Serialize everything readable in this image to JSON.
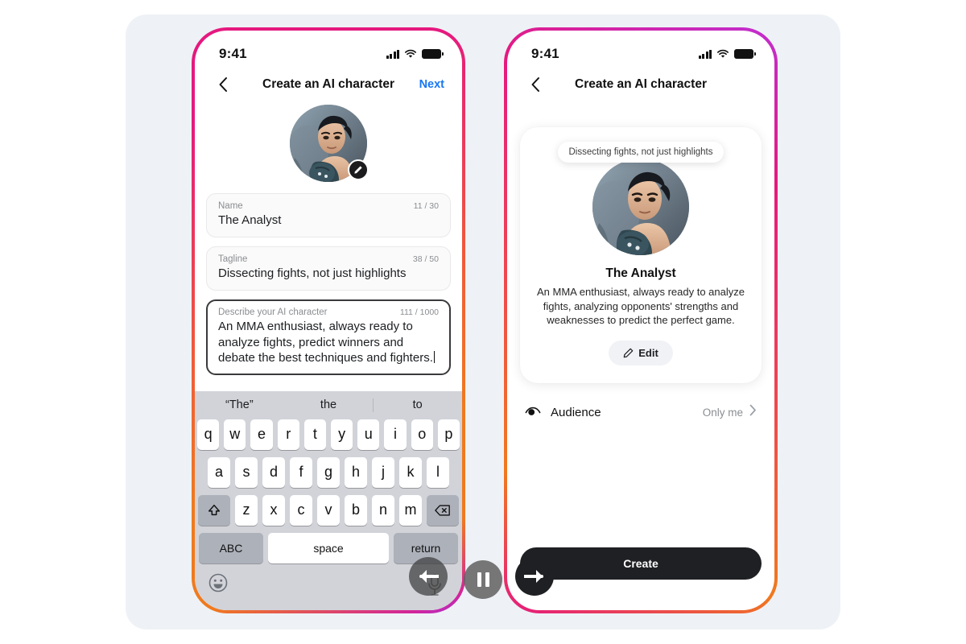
{
  "theme": {
    "stage_bg": "#eef2f6",
    "accent_link": "#1877f2",
    "dark_button": "#1f2023",
    "keyboard_bg": "#d1d3d9",
    "muted_text": "#8a8d91",
    "frame_gradient_left": "#e5197f → #f07a1e → #a832d6",
    "frame_gradient_right": "#c02fd0 → #e5197f → #f07a1e"
  },
  "left_phone": {
    "status": {
      "time": "9:41",
      "cellular": "signal-bars",
      "wifi": "wifi",
      "battery": "battery-full"
    },
    "nav": {
      "back": "chevron-left",
      "title": "Create an AI character",
      "next_label": "Next"
    },
    "avatar": {
      "alt": "MMA fighter character portrait",
      "edit_badge": "pencil-icon"
    },
    "fields": [
      {
        "key": "name",
        "label": "Name",
        "count": "11 / 30",
        "value": "The Analyst",
        "focused": false
      },
      {
        "key": "tagline",
        "label": "Tagline",
        "count": "38 / 50",
        "value": "Dissecting fights, not just highlights",
        "focused": false
      },
      {
        "key": "description",
        "label": "Describe your AI character",
        "count": "111 / 1000",
        "value": "An MMA enthusiast, always ready to analyze fights, predict winners and debate the best techniques and fighters.",
        "focused": true
      }
    ],
    "keyboard": {
      "suggestions": [
        "“The”",
        "the",
        "to"
      ],
      "row1": [
        "q",
        "w",
        "e",
        "r",
        "t",
        "y",
        "u",
        "i",
        "o",
        "p"
      ],
      "row2": [
        "a",
        "s",
        "d",
        "f",
        "g",
        "h",
        "j",
        "k",
        "l"
      ],
      "row3": [
        "z",
        "x",
        "c",
        "v",
        "b",
        "n",
        "m"
      ],
      "shift_key": "shift-icon",
      "backspace_key": "backspace-icon",
      "abc_label": "ABC",
      "space_label": "space",
      "return_label": "return",
      "emoji_key": "emoji-icon",
      "mic_key": "microphone-icon"
    }
  },
  "right_phone": {
    "status": {
      "time": "9:41",
      "cellular": "signal-bars",
      "wifi": "wifi",
      "battery": "battery-full"
    },
    "nav": {
      "back": "chevron-left",
      "title": "Create an AI character"
    },
    "preview": {
      "bubble_text": "Dissecting fights, not just highlights",
      "avatar_alt": "MMA fighter character portrait",
      "name": "The Analyst",
      "description": "An MMA enthusiast, always ready to analyze fights, analyzing opponents' strengths and weaknesses to predict the perfect game.",
      "edit_label": "Edit",
      "edit_icon": "pencil-icon"
    },
    "audience": {
      "icon": "eye-icon",
      "label": "Audience",
      "value": "Only me",
      "chevron": "chevron-right"
    },
    "create_label": "Create"
  },
  "overlay_controls": {
    "prev": "arrow-left-icon",
    "pause": "pause-icon",
    "next": "arrow-right-icon"
  }
}
